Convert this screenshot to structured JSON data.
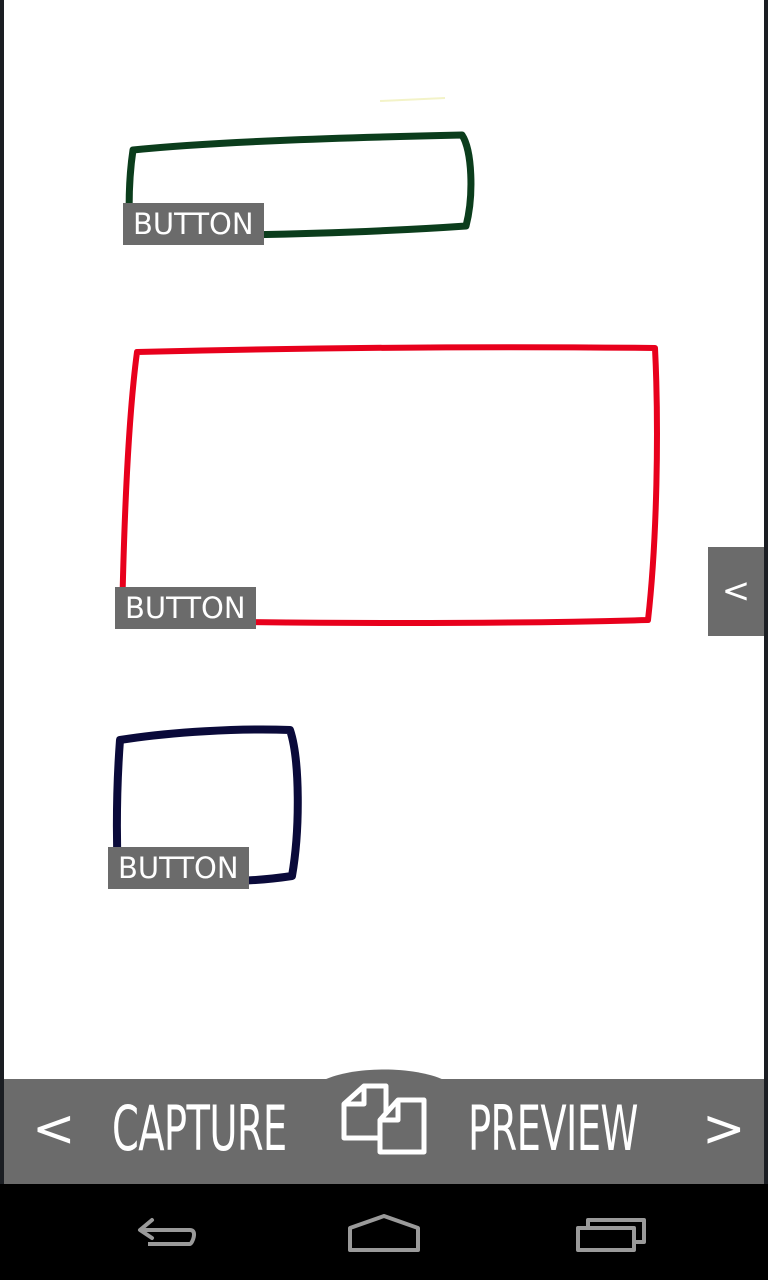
{
  "sketch": {
    "components": [
      {
        "label": "BUTTON",
        "stroke_color": "#0b3d1c"
      },
      {
        "label": "BUTTON",
        "stroke_color": "#e8001c"
      },
      {
        "label": "BUTTON",
        "stroke_color": "#0a0a3a"
      }
    ]
  },
  "side_panel": {
    "toggle_label": "<"
  },
  "toolbar": {
    "prev_label": "<",
    "capture_label": "CAPTURE",
    "preview_label": "PREVIEW",
    "next_label": ">",
    "copy_icon": "copy-icon"
  },
  "system_nav": {
    "back_icon": "back-icon",
    "home_icon": "home-icon",
    "recents_icon": "recents-icon"
  },
  "colors": {
    "bar_background": "#6b6b6b",
    "canvas_background": "#ffffff",
    "nav_background": "#000000"
  }
}
